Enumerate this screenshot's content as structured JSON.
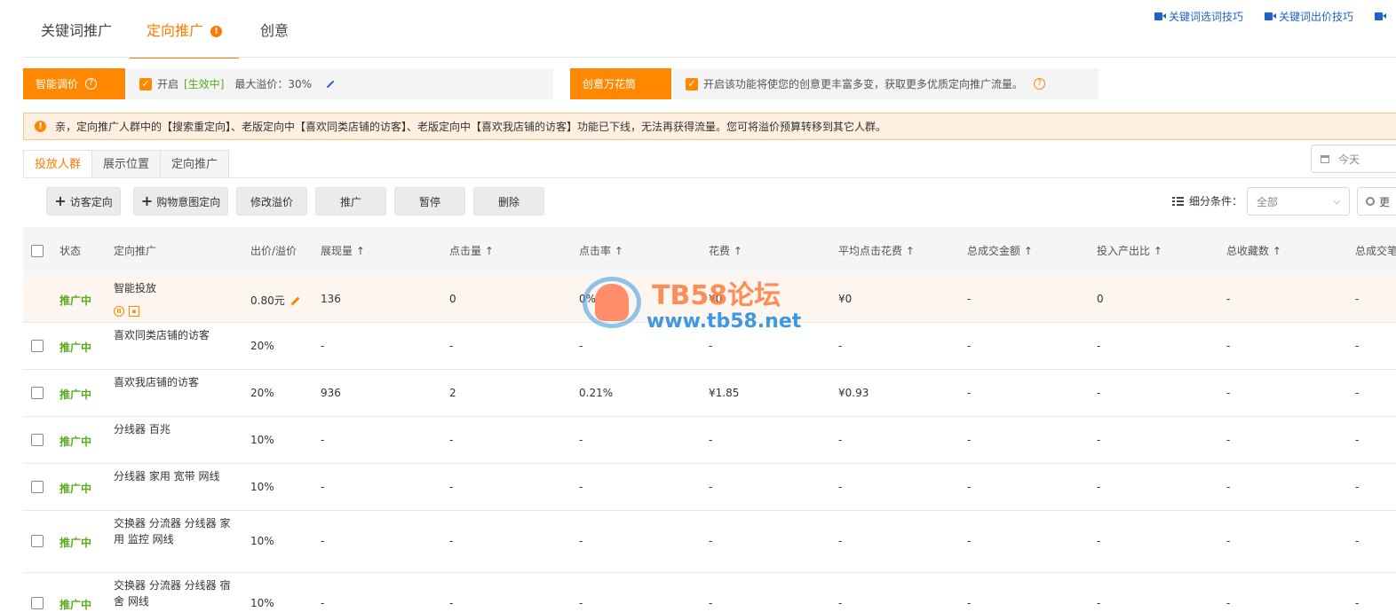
{
  "top_tabs": [
    {
      "label": "关键词推广"
    },
    {
      "label": "定向推广",
      "info_icon": "!"
    },
    {
      "label": "创意"
    }
  ],
  "help_links": [
    "关键词选词技巧",
    "关键词出价技巧"
  ],
  "smart_bid": {
    "label": "智能调价",
    "help_icon": "?",
    "check_label": "开启",
    "status": "[生效中]",
    "max_premium": "最大溢价：30%"
  },
  "creative": {
    "label": "创意万花筒",
    "description": "开启该功能将使您的创意更丰富多变，获取更多优质定向推广流量。",
    "help_icon": "?"
  },
  "notice": {
    "icon": "!",
    "text": "亲，定向推广人群中的【搜索重定向】、老版定向中【喜欢同类店铺的访客】、老版定向中【喜欢我店铺的访客】功能已下线，无法再获得流量。您可将溢价预算转移到其它人群。"
  },
  "sub_tabs": [
    "投放人群",
    "展示位置",
    "定向推广"
  ],
  "date_filter": {
    "value": "今天"
  },
  "toolbar": {
    "visitor_target": "访客定向",
    "purchase_intent": "购物意图定向",
    "edit_premium": "修改溢价",
    "promote": "推广",
    "pause": "暂停",
    "delete": "删除",
    "filter_label": "细分条件：",
    "filter_value": "全部",
    "more": "更"
  },
  "table": {
    "headers": [
      "状态",
      "定向推广",
      "出价/溢价",
      "展现量 ↑",
      "点击量 ↑",
      "点击率 ↑",
      "花费 ↑",
      "平均点击花费 ↑",
      "总成交金额 ↑",
      "投入产出比 ↑",
      "总收藏数 ↑",
      "总成交笔"
    ],
    "rows": [
      {
        "status": "推广中",
        "name": "智能投放",
        "bid": "0.80元",
        "impressions": "136",
        "clicks": "0",
        "ctr": "0%",
        "cost": "¥0",
        "cpc": "¥0",
        "gmv": "-",
        "roi": "0",
        "favorites": "-",
        "orders": "-"
      },
      {
        "status": "推广中",
        "name": "喜欢同类店铺的访客",
        "bid": "20%",
        "impressions": "-",
        "clicks": "-",
        "ctr": "-",
        "cost": "-",
        "cpc": "-",
        "gmv": "-",
        "roi": "-",
        "favorites": "-",
        "orders": "-"
      },
      {
        "status": "推广中",
        "name": "喜欢我店铺的访客",
        "bid": "20%",
        "impressions": "936",
        "clicks": "2",
        "ctr": "0.21%",
        "cost": "¥1.85",
        "cpc": "¥0.93",
        "gmv": "-",
        "roi": "-",
        "favorites": "-",
        "orders": "-"
      },
      {
        "status": "推广中",
        "name": "分线器 百兆",
        "bid": "10%",
        "impressions": "-",
        "clicks": "-",
        "ctr": "-",
        "cost": "-",
        "cpc": "-",
        "gmv": "-",
        "roi": "-",
        "favorites": "-",
        "orders": "-"
      },
      {
        "status": "推广中",
        "name": "分线器 家用 宽带 网线",
        "bid": "10%",
        "impressions": "-",
        "clicks": "-",
        "ctr": "-",
        "cost": "-",
        "cpc": "-",
        "gmv": "-",
        "roi": "-",
        "favorites": "-",
        "orders": "-"
      },
      {
        "status": "推广中",
        "name": "交换器 分流器 分线器 家用 监控 网线",
        "bid": "10%",
        "impressions": "-",
        "clicks": "-",
        "ctr": "-",
        "cost": "-",
        "cpc": "-",
        "gmv": "-",
        "roi": "-",
        "favorites": "-",
        "orders": "-"
      },
      {
        "status": "推广中",
        "name": "交换器 分流器 分线器 宿舍 网线",
        "bid": "10%",
        "impressions": "-",
        "clicks": "-",
        "ctr": "-",
        "cost": "-",
        "cpc": "-",
        "gmv": "-",
        "roi": "-",
        "favorites": "-",
        "orders": "-"
      }
    ]
  },
  "watermark": {
    "title": "TB58论坛",
    "url": "www.tb58.net"
  },
  "colors": {
    "accent": "#ff8800",
    "status_green": "#5aaa1e",
    "link_blue": "#2062c8"
  }
}
